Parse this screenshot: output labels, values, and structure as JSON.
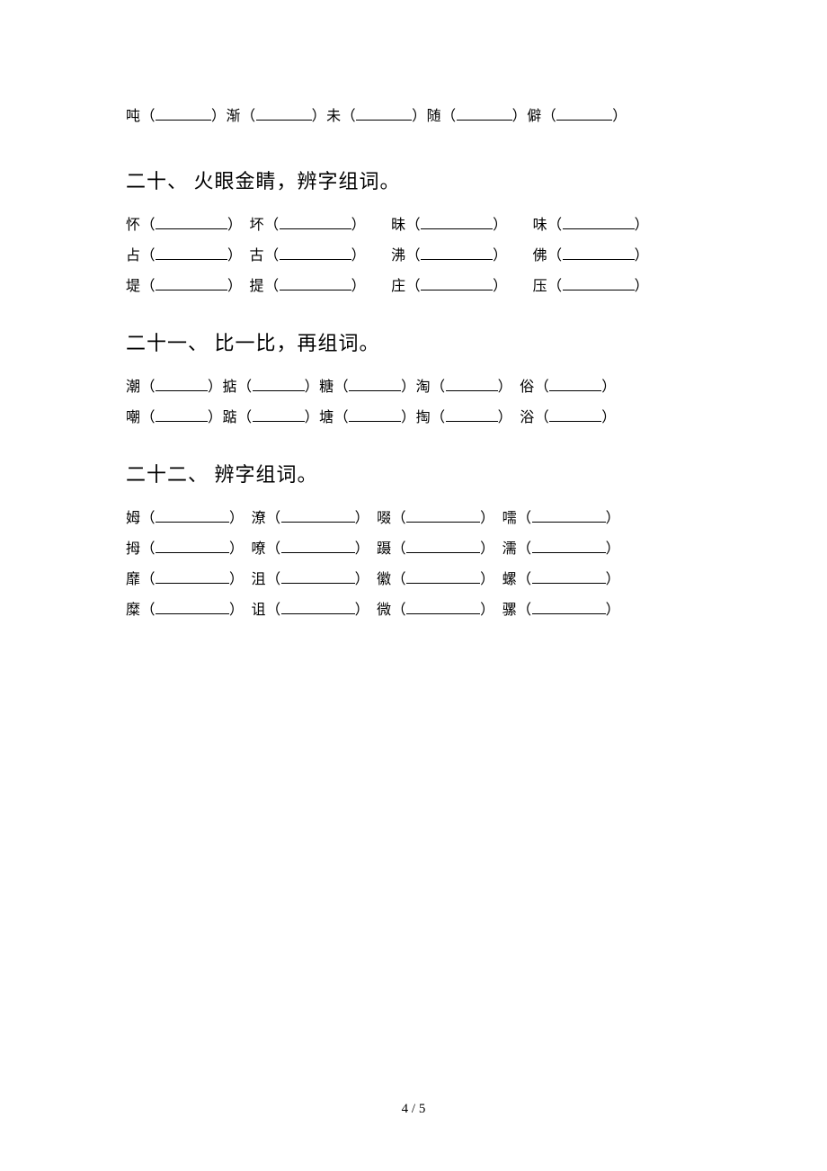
{
  "top_line": {
    "c1": "吨",
    "c2": "渐",
    "c3": "未",
    "c4": "随",
    "c5": "僻"
  },
  "section20": {
    "heading": "二十、 火眼金睛，辨字组词。",
    "rows": [
      [
        "怀",
        "坏",
        "昧",
        "味"
      ],
      [
        "占",
        "古",
        "沸",
        "佛"
      ],
      [
        "堤",
        "提",
        "庄",
        "压"
      ]
    ]
  },
  "section21": {
    "heading": "二十一、 比一比，再组词。",
    "rows": [
      [
        "潮",
        "掂",
        "糖",
        "淘",
        "俗"
      ],
      [
        "嘲",
        "踮",
        "塘",
        "掏",
        "浴"
      ]
    ]
  },
  "section22": {
    "heading": "二十二、 辨字组词。",
    "rows": [
      [
        "姆",
        "潦",
        "啜",
        "嚅"
      ],
      [
        "拇",
        "嘹",
        "蹑",
        "濡"
      ],
      [
        "靡",
        "沮",
        "徽",
        "螺"
      ],
      [
        "糜",
        "诅",
        "微",
        "骡"
      ]
    ]
  },
  "footer": "4 / 5"
}
